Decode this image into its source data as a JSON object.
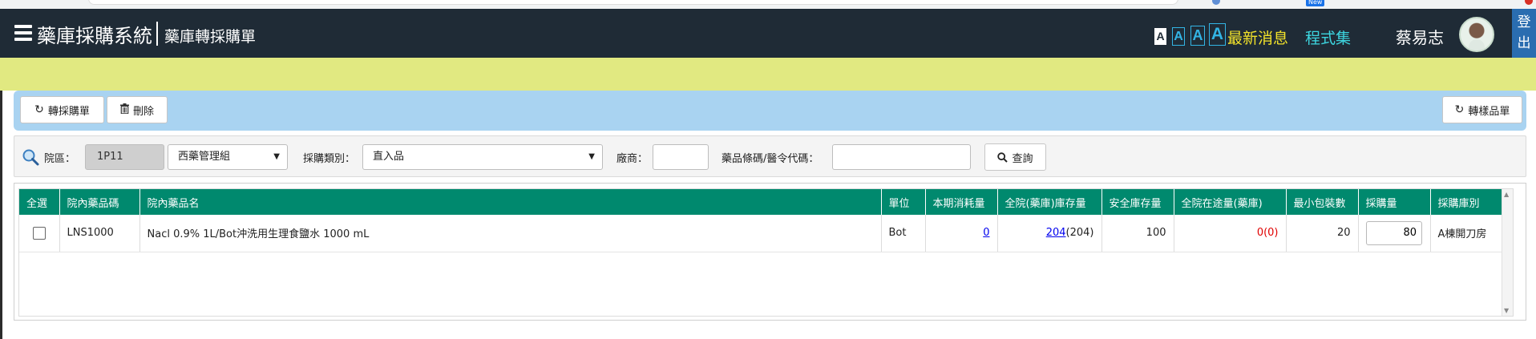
{
  "header": {
    "brand": "藥庫採購系統",
    "subtitle": "藥庫轉採購單",
    "font_sizes": [
      "A",
      "A",
      "A",
      "A"
    ],
    "news_label": "最新消息",
    "programs_label": "程式集",
    "user_name": "蔡易志",
    "logout_label": "登出"
  },
  "browser": {
    "new_badge": "New"
  },
  "toolbar": {
    "transfer_label": "轉採購單",
    "delete_label": "刪除",
    "sample_label": "轉樣品單"
  },
  "filters": {
    "campus_label": "院區：",
    "campus_value": "1P11",
    "group_value": "西藥管理組",
    "type_label": "採購類別：",
    "type_value": "直入品",
    "vendor_label": "廠商：",
    "vendor_value": "",
    "code_label": "藥品條碼/醫令代碼：",
    "code_value": "",
    "query_label": "查詢"
  },
  "table": {
    "headers": [
      "全選",
      "院內藥品碼",
      "院內藥品名",
      "單位",
      "本期消耗量",
      "全院(藥庫)庫存量",
      "安全庫存量",
      "全院在途量(藥庫)",
      "最小包裝數",
      "採購量",
      "採購庫別"
    ],
    "rows": [
      {
        "code": "LNS1000",
        "name": "Nacl 0.9% 1L/Bot沖洗用生理食鹽水 1000 mL",
        "unit": "Bot",
        "consumption": "0",
        "stock_link": "204",
        "stock_paren": "(204)",
        "safety_stock": "100",
        "in_transit": "0(0)",
        "min_pack": "20",
        "purchase_qty": "80",
        "warehouse": "A棟開刀房"
      }
    ]
  },
  "colors": {
    "navbar": "#1f2b36",
    "yellow_band": "#e1e981",
    "toolbar": "#a9d3f1",
    "table_header": "#00896e",
    "news": "#f2e22a",
    "programs": "#3dd6e0",
    "logout": "#2a6db0"
  }
}
